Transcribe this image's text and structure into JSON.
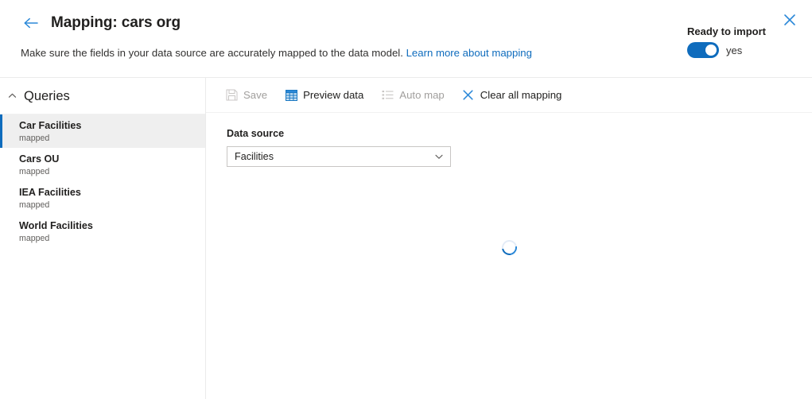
{
  "header": {
    "back_icon": "arrow-left-icon",
    "title": "Mapping: cars org",
    "subtitle_text": "Make sure the fields in your data source are accurately mapped to the data model.",
    "subtitle_link": "Learn more about mapping",
    "ready_label": "Ready to import",
    "toggle_value": "yes",
    "toggle_on": true,
    "close_icon": "close-icon",
    "accent_color": "#0f6cbd",
    "link_color": "#0f6cbd"
  },
  "sidebar": {
    "section_title": "Queries",
    "collapse_icon": "chevron-up-icon",
    "items": [
      {
        "name": "Car Facilities",
        "status": "mapped",
        "selected": true
      },
      {
        "name": "Cars OU",
        "status": "mapped",
        "selected": false
      },
      {
        "name": "IEA Facilities",
        "status": "mapped",
        "selected": false
      },
      {
        "name": "World Facilities",
        "status": "mapped",
        "selected": false
      }
    ]
  },
  "toolbar": {
    "buttons": [
      {
        "label": "Save",
        "icon": "save-icon",
        "disabled": true
      },
      {
        "label": "Preview data",
        "icon": "table-grid-icon",
        "disabled": false
      },
      {
        "label": "Auto map",
        "icon": "list-icon",
        "disabled": true
      },
      {
        "label": "Clear all mapping",
        "icon": "close-icon",
        "disabled": false
      }
    ]
  },
  "main": {
    "data_source_label": "Data source",
    "data_source_value": "Facilities",
    "dropdown_icon": "chevron-down-icon",
    "loading_icon": "spinner-icon"
  }
}
